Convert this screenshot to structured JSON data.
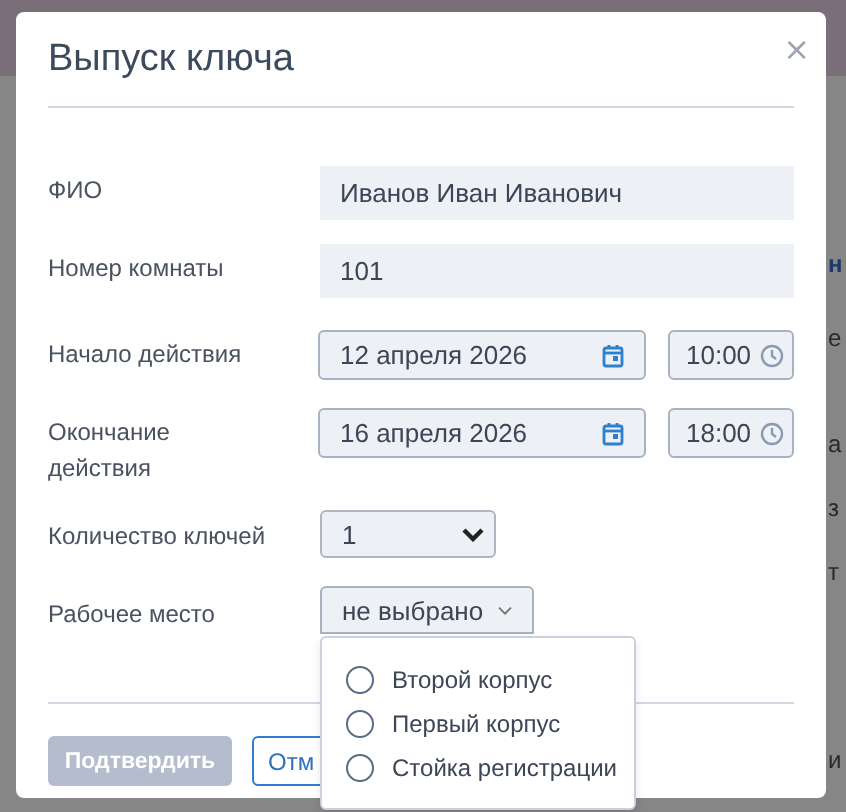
{
  "background_page": [
    {
      "text": "н",
      "bold": true
    },
    {
      "text": "е",
      "bold": false
    },
    {
      "text": "а",
      "bold": false
    },
    {
      "text": "з",
      "bold": false
    },
    {
      "text": "т",
      "bold": false
    },
    {
      "text": "и",
      "bold": false
    }
  ],
  "dialog": {
    "title": "Выпуск ключа",
    "close": "×",
    "fields": [
      {
        "kind": "text",
        "label": "ФИО",
        "value": "Иванов Иван Иванович"
      },
      {
        "kind": "text",
        "label": "Номер комнаты",
        "value": "101"
      },
      {
        "kind": "datetime",
        "label": "Начало действия",
        "date": "12 апреля 2026",
        "time": "10:00"
      },
      {
        "kind": "datetime",
        "label": "Окончание действия",
        "date": "16 апреля 2026",
        "time": "18:00"
      },
      {
        "kind": "select",
        "label": "Количество ключей",
        "value": "1"
      },
      {
        "kind": "dropdown",
        "label": "Рабочее место",
        "value": "не выбрано",
        "expanded": true,
        "options": [
          {
            "label": "Второй корпус",
            "selected": false
          },
          {
            "label": "Первый корпус",
            "selected": false
          },
          {
            "label": "Стойка регистрации",
            "selected": false
          }
        ]
      }
    ],
    "buttons": [
      {
        "kind": "primary",
        "label": "Подтвердить",
        "disabled": true
      },
      {
        "kind": "secondary",
        "label": "Отм",
        "disabled": false
      }
    ]
  }
}
